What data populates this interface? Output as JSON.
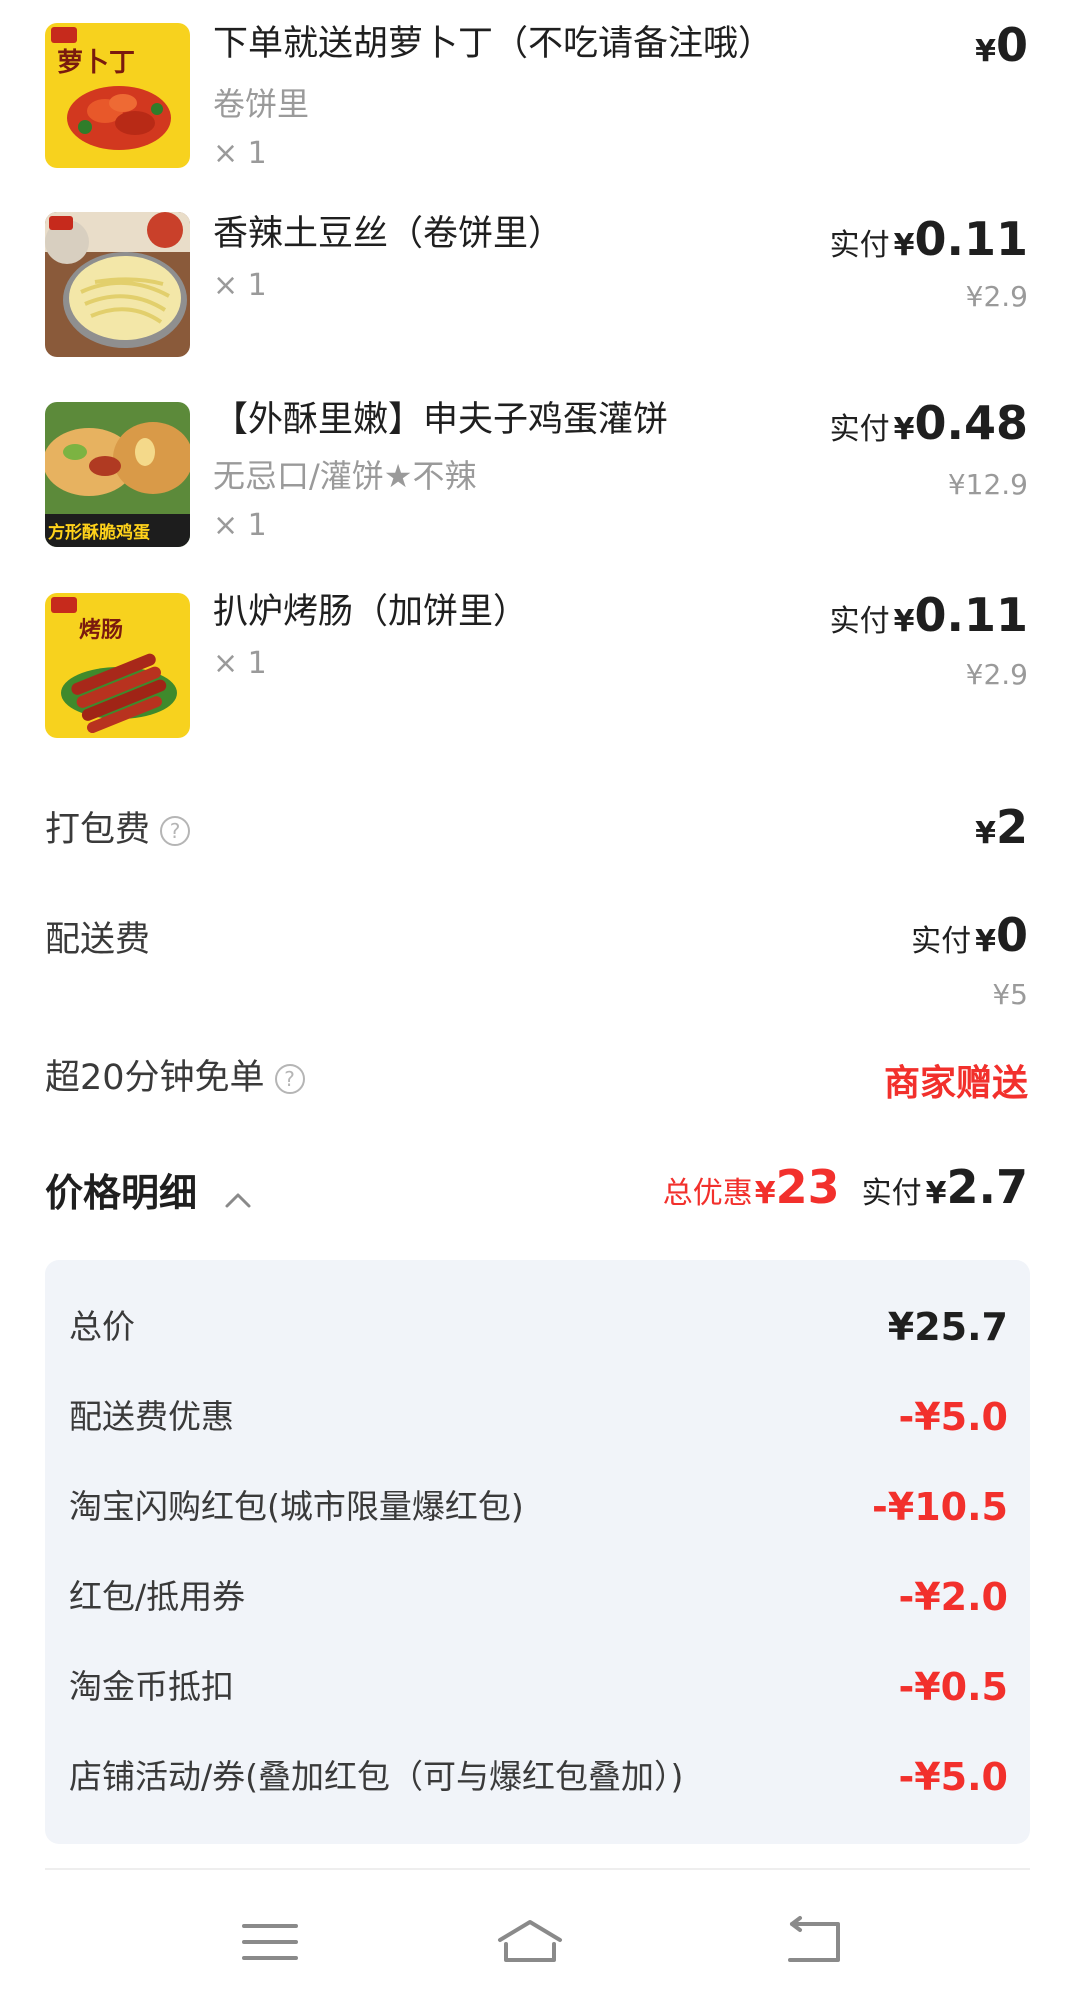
{
  "items": [
    {
      "name": "下单就送胡萝卜丁（不吃请备注哦）",
      "spec": "卷饼里",
      "qty": "× 1",
      "paid_label": "",
      "yen": "¥",
      "price": "0",
      "original": "",
      "thumb_caption": "萝卜丁"
    },
    {
      "name": "香辣土豆丝（卷饼里）",
      "spec": "",
      "qty": "× 1",
      "paid_label": "实付",
      "yen": "¥",
      "price": "0.11",
      "original": "¥2.9",
      "thumb_caption": ""
    },
    {
      "name": "【外酥里嫩】申夫子鸡蛋灌饼",
      "spec": "无忌口/灌饼★不辣",
      "qty": "× 1",
      "paid_label": "实付",
      "yen": "¥",
      "price": "0.48",
      "original": "¥12.9",
      "thumb_caption": "方形酥脆鸡蛋"
    },
    {
      "name": "扒炉烤肠（加饼里）",
      "spec": "",
      "qty": "× 1",
      "paid_label": "实付",
      "yen": "¥",
      "price": "0.11",
      "original": "¥2.9",
      "thumb_caption": "烤肠"
    }
  ],
  "fees": {
    "packing": {
      "label": "打包费",
      "yen": "¥",
      "value": "2",
      "help_icon": "question-circle-icon"
    },
    "delivery": {
      "label": "配送费",
      "paid_label": "实付",
      "yen": "¥",
      "value": "0",
      "original": "¥5"
    },
    "late_free": {
      "label": "超20分钟免单",
      "value": "商家赠送",
      "help_icon": "question-circle-icon"
    }
  },
  "price_detail": {
    "title": "价格明细",
    "discount_label": "总优惠",
    "discount_yen": "¥",
    "discount_value": "23",
    "paid_label": "实付",
    "paid_yen": "¥",
    "paid_value": "2.7",
    "lines": [
      {
        "label": "总价",
        "value": "¥25.7",
        "tone": "black"
      },
      {
        "label": "配送费优惠",
        "value": "-¥5.0",
        "tone": "red"
      },
      {
        "label": "淘宝闪购红包(城市限量爆红包)",
        "value": "-¥10.5",
        "tone": "red"
      },
      {
        "label": "红包/抵用券",
        "value": "-¥2.0",
        "tone": "red"
      },
      {
        "label": "淘金币抵扣",
        "value": "-¥0.5",
        "tone": "red"
      },
      {
        "label": "店铺活动/券(叠加红包（可与爆红包叠加）)",
        "value": "-¥5.0",
        "tone": "red"
      }
    ]
  },
  "colors": {
    "accent_red": "#f2302c",
    "panel_bg": "#f1f4f9",
    "muted_text": "#9a9a9a"
  },
  "nav": {
    "menu_icon": "menu-icon",
    "home_icon": "home-icon",
    "back_icon": "back-icon"
  }
}
